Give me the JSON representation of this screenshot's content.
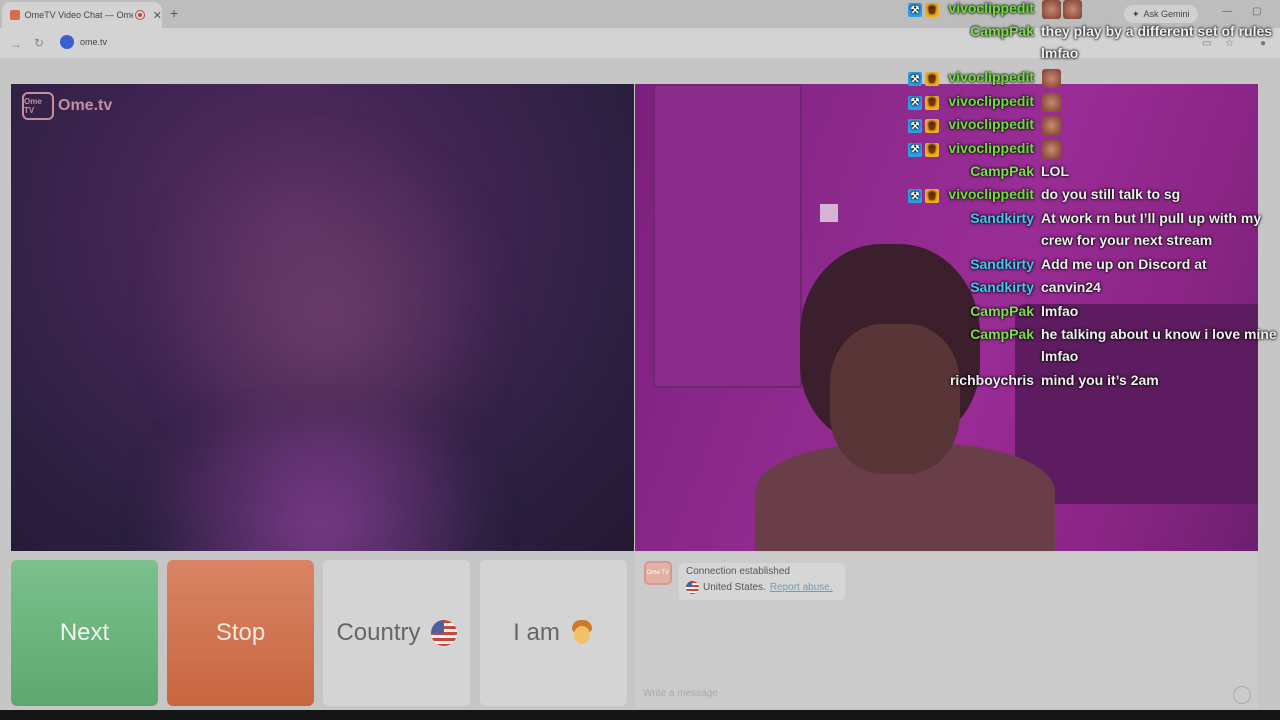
{
  "browser": {
    "tab_title": "OmeTV Video Chat — Ome",
    "tab_close": "✕",
    "new_tab": "+",
    "url": "ome.tv",
    "ask_gemini": "Ask Gemini",
    "minimize": "—",
    "maximize": "▢"
  },
  "app": {
    "logo_badge": "Ome TV",
    "logo_text": "Ome.tv",
    "buttons": {
      "next": "Next",
      "stop": "Stop",
      "country": "Country",
      "iam": "I am"
    },
    "system": {
      "line1": "Connection established",
      "country": "United States.",
      "report": "Report abuse."
    },
    "input_placeholder": "Write a message"
  },
  "chat": [
    {
      "user": "vivoclippedit",
      "user_color": "#6fe03a",
      "badges": true,
      "emotes": 2
    },
    {
      "user": "CampPak",
      "user_color": "#7be14a",
      "text": "they play by a different set of rules",
      "text2": "lmfao"
    },
    {
      "user": "vivoclippedit",
      "user_color": "#6fe03a",
      "badges": true,
      "emotes": 1
    },
    {
      "user": "vivoclippedit",
      "user_color": "#6fe03a",
      "badges": true,
      "emotes": 1
    },
    {
      "user": "vivoclippedit",
      "user_color": "#6fe03a",
      "badges": true,
      "emotes": 1
    },
    {
      "user": "vivoclippedit",
      "user_color": "#6fe03a",
      "badges": true,
      "emotes": 1
    },
    {
      "user": "CampPak",
      "user_color": "#7be14a",
      "text": "LOL"
    },
    {
      "user": "vivoclippedit",
      "user_color": "#6fe03a",
      "badges": true,
      "text": "do you still talk to sg"
    },
    {
      "user": "Sandkirty",
      "user_color": "#3ec9f0",
      "text": "At work rn but I’ll pull up with my",
      "text2": "crew for your next stream"
    },
    {
      "user": "Sandkirty",
      "user_color": "#3ec9f0",
      "text": "Add me up on Discord at"
    },
    {
      "user": "Sandkirty",
      "user_color": "#3ec9f0",
      "text": "canvin24"
    },
    {
      "user": "CampPak",
      "user_color": "#7be14a",
      "text": "lmfao"
    },
    {
      "user": "CampPak",
      "user_color": "#7be14a",
      "text": "he talking about u know i love mine",
      "text2": "lmfao"
    },
    {
      "user": "richboychris",
      "user_color": "#f1f1f1",
      "text": "mind you it’s 2am"
    }
  ]
}
